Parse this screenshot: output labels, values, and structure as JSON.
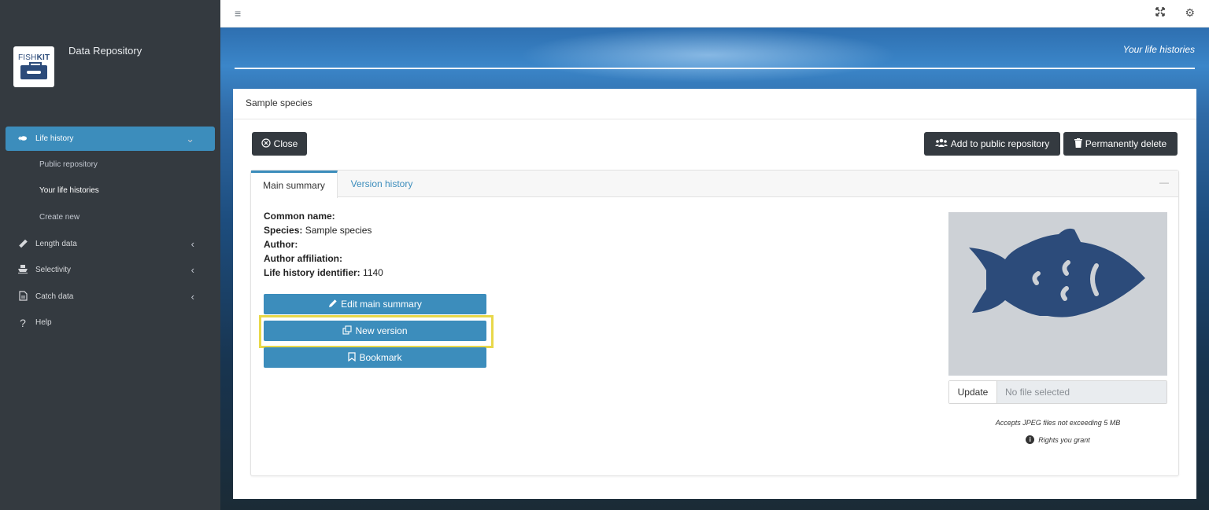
{
  "app": {
    "title": "Data Repository",
    "logo_text_light": "FISH",
    "logo_text_bold": "KIT"
  },
  "sidebar": {
    "items": [
      {
        "label": "Life history",
        "icon": "fish-icon"
      },
      {
        "label": "Length data",
        "icon": "ruler-icon"
      },
      {
        "label": "Selectivity",
        "icon": "boat-icon"
      },
      {
        "label": "Catch data",
        "icon": "file-icon"
      },
      {
        "label": "Help",
        "icon": "question-icon"
      }
    ],
    "subitems": [
      {
        "label": "Public repository"
      },
      {
        "label": "Your life histories"
      },
      {
        "label": "Create new"
      }
    ]
  },
  "topbar": {
    "menu_icon": "hamburger-icon",
    "fullscreen_icon": "expand-icon",
    "settings_icon": "gear-icon"
  },
  "banner": {
    "title": "Your life histories"
  },
  "card": {
    "title": "Sample species",
    "close_label": "Close",
    "add_public_label": "Add to public repository",
    "delete_label": "Permanently delete"
  },
  "tabs": [
    {
      "label": "Main summary"
    },
    {
      "label": "Version history"
    }
  ],
  "summary": {
    "common_name_label": "Common name:",
    "common_name_value": "",
    "species_label": "Species:",
    "species_value": "Sample species",
    "author_label": "Author:",
    "author_value": "",
    "affiliation_label": "Author affiliation:",
    "affiliation_value": "",
    "identifier_label": "Life history identifier:",
    "identifier_value": "1140"
  },
  "actions": {
    "edit_label": "Edit main summary",
    "new_version_label": "New version",
    "bookmark_label": "Bookmark"
  },
  "image": {
    "update_label": "Update",
    "file_placeholder": "No file selected",
    "accepts_text": "Accepts JPEG files not exceeding 5 MB",
    "rights_text": "Rights you grant"
  },
  "colors": {
    "accent": "#3c8dbc",
    "sidebar": "#343a40",
    "highlight": "#e8d84a",
    "fish": "#2c4b7a"
  }
}
